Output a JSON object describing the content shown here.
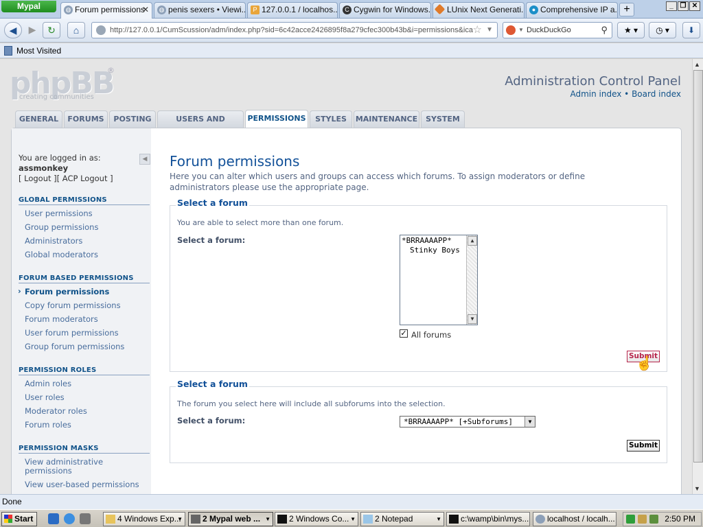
{
  "browser": {
    "app_button": "Mypal",
    "tabs": [
      {
        "title": "Forum permissions",
        "icon": "globe-icon",
        "active": true
      },
      {
        "title": "penis sexers • Viewi...",
        "icon": "globe-icon",
        "active": false
      },
      {
        "title": "127.0.0.1 / localhos...",
        "icon": "pma-icon",
        "active": false
      },
      {
        "title": "Cygwin for Windows...",
        "icon": "cygwin-icon",
        "active": false
      },
      {
        "title": "LUnix Next Generati...",
        "icon": "diamond-icon",
        "active": false
      },
      {
        "title": "Comprehensive IP a...",
        "icon": "location-icon",
        "active": false
      }
    ],
    "url": "http://127.0.0.1/CumScussion/adm/index.php?sid=6c42acce2426895f8a279cfec300b43b&i=permissions&ica",
    "search_engine": "DuckDuckGo",
    "bookmarks": [
      "Most Visited"
    ],
    "status": "Done"
  },
  "acp": {
    "logo_text": "phpBB",
    "logo_tagline": "creating  communities",
    "header_title": "Administration Control Panel",
    "header_links": [
      "Admin index",
      "Board index"
    ],
    "header_link_separator": "•",
    "tabs": [
      "GENERAL",
      "FORUMS",
      "POSTING",
      "USERS AND GROUPS",
      "PERMISSIONS",
      "STYLES",
      "MAINTENANCE",
      "SYSTEM"
    ],
    "active_tab": "PERMISSIONS"
  },
  "sidebar": {
    "logged_in_label": "You are logged in as:",
    "username": "assmonkey",
    "logout_links": "[ Logout ][ ACP Logout ]",
    "sections": [
      {
        "title": "GLOBAL PERMISSIONS",
        "items": [
          "User permissions",
          "Group permissions",
          "Administrators",
          "Global moderators"
        ]
      },
      {
        "title": "FORUM BASED PERMISSIONS",
        "items": [
          "Forum permissions",
          "Copy forum permissions",
          "Forum moderators",
          "User forum permissions",
          "Group forum permissions"
        ]
      },
      {
        "title": "PERMISSION ROLES",
        "items": [
          "Admin roles",
          "User roles",
          "Moderator roles",
          "Forum roles"
        ]
      },
      {
        "title": "PERMISSION MASKS",
        "items": [
          "View administrative permissions",
          "View user-based permissions"
        ]
      }
    ],
    "current_item": "Forum permissions"
  },
  "main": {
    "title": "Forum permissions",
    "intro": "Here you can alter which users and groups can access which forums. To assign moderators or define administrators please use the appropriate page.",
    "fieldset1": {
      "legend": "Select a forum",
      "note": "You are able to select more than one forum.",
      "label": "Select a forum:",
      "options": [
        "*BRRAAAAPP*",
        "Stinky Boys"
      ],
      "all_forums_label": "All forums",
      "all_forums_checked": true,
      "check_mark": "✓",
      "submit": "Submit"
    },
    "fieldset2": {
      "legend": "Select a forum",
      "note": "The forum you select here will include all subforums into the selection.",
      "label": "Select a forum:",
      "selected": "*BRRAAAAPP* [+Subforums]",
      "submit": "Submit"
    }
  },
  "taskbar": {
    "start": "Start",
    "tasks": [
      {
        "label": "4 Windows Exp...",
        "active": false
      },
      {
        "label": "2 Mypal web ...",
        "active": true
      },
      {
        "label": "2 Windows Co...",
        "active": false
      },
      {
        "label": "2 Notepad",
        "active": false
      },
      {
        "label": "c:\\wamp\\bin\\mys...",
        "active": false
      },
      {
        "label": "localhost / localh...",
        "active": false
      }
    ],
    "clock": "2:50 PM"
  }
}
